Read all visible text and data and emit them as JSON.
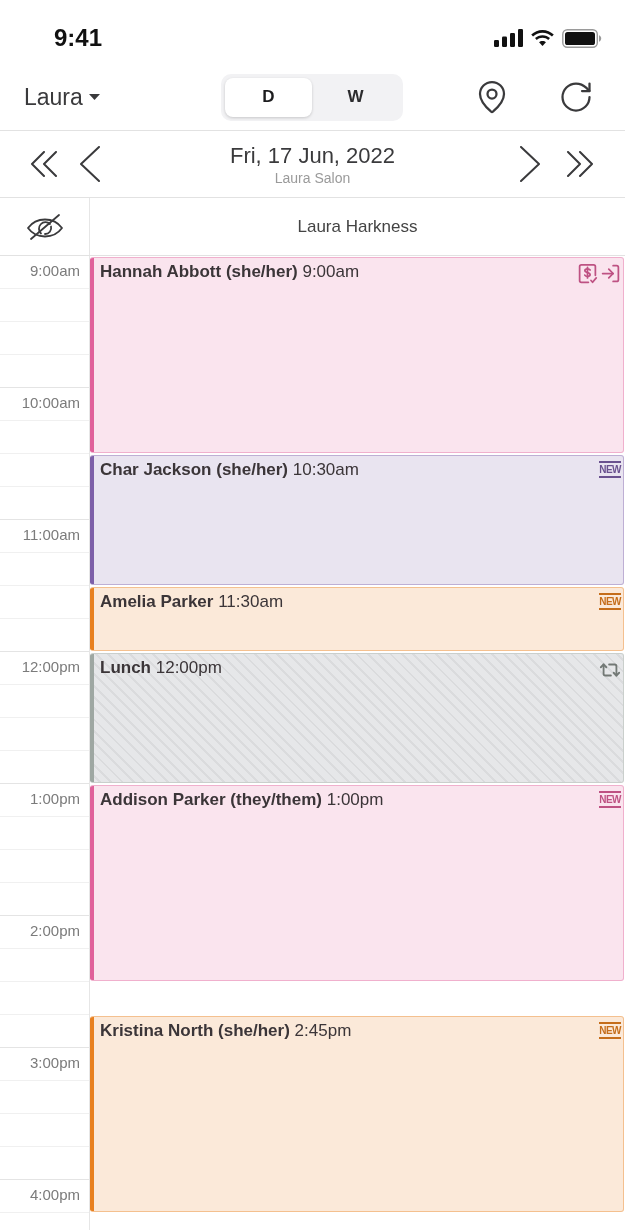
{
  "status_bar": {
    "time": "9:41"
  },
  "header": {
    "user": "Laura",
    "view_tabs": [
      {
        "label": "D",
        "selected": true
      },
      {
        "label": "W",
        "selected": false
      }
    ]
  },
  "date_nav": {
    "date": "Fri, 17 Jun, 2022",
    "location": "Laura Salon"
  },
  "staff_header": {
    "staff_name": "Laura Harkness"
  },
  "time_labels": [
    "9:00am",
    "10:00am",
    "11:00am",
    "12:00pm",
    "1:00pm",
    "2:00pm",
    "3:00pm",
    "4:00pm"
  ],
  "appointments": [
    {
      "kind": "appointment",
      "name": "Hannah Abbott (she/her)",
      "time": "9:00am",
      "color": "#e0609a",
      "paid": true,
      "checked_in": true,
      "recurring": false
    },
    {
      "kind": "appointment",
      "name": "Char Jackson (she/her)",
      "time": "10:30am",
      "color": "#7d5fa8",
      "badge": "NEW",
      "paid": false,
      "checked_in": false,
      "recurring": false
    },
    {
      "kind": "appointment",
      "name": "Amelia Parker",
      "time": "11:30am",
      "color": "#e8801f",
      "badge": "NEW",
      "paid": false,
      "checked_in": false,
      "recurring": false
    },
    {
      "kind": "break",
      "name": "Lunch",
      "time": "12:00pm",
      "color": "#9ea7a2",
      "paid": false,
      "checked_in": false,
      "recurring": true
    },
    {
      "kind": "appointment",
      "name": "Addison Parker (they/them)",
      "time": "1:00pm",
      "color": "#e0609a",
      "badge": "NEW",
      "paid": false,
      "checked_in": false,
      "recurring": false
    },
    {
      "kind": "appointment",
      "name": "Kristina North (she/her)",
      "time": "2:45pm",
      "color": "#e8801f",
      "badge": "NEW",
      "paid": false,
      "checked_in": false,
      "recurring": false
    }
  ]
}
